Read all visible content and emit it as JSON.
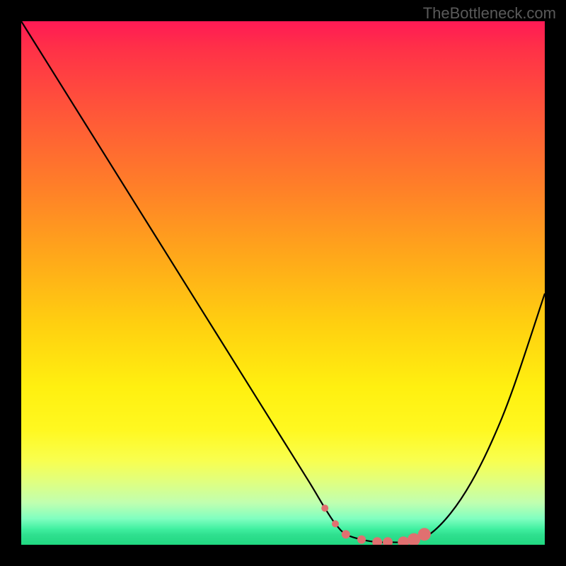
{
  "attribution": "TheBottleneck.com",
  "chart_data": {
    "type": "line",
    "title": "",
    "xlabel": "",
    "ylabel": "",
    "xlim": [
      0,
      100
    ],
    "ylim": [
      0,
      100
    ],
    "series": [
      {
        "name": "bottleneck-curve",
        "x": [
          0,
          5,
          10,
          15,
          20,
          25,
          30,
          35,
          40,
          45,
          50,
          55,
          58,
          60,
          62,
          65,
          68,
          70,
          73,
          75,
          78,
          82,
          86,
          90,
          94,
          100
        ],
        "y": [
          100,
          92,
          84,
          76,
          68,
          60,
          52,
          44,
          36,
          28,
          20,
          12,
          7,
          4,
          2,
          1,
          0.5,
          0.5,
          0.5,
          1,
          2,
          6,
          12,
          20,
          30,
          48
        ]
      }
    ],
    "markers": {
      "name": "highlight-dots",
      "color": "#e07070",
      "points": [
        {
          "x": 58,
          "y": 7,
          "r": 5
        },
        {
          "x": 60,
          "y": 4,
          "r": 5
        },
        {
          "x": 62,
          "y": 2,
          "r": 6
        },
        {
          "x": 65,
          "y": 1,
          "r": 6
        },
        {
          "x": 68,
          "y": 0.5,
          "r": 7
        },
        {
          "x": 70,
          "y": 0.5,
          "r": 7
        },
        {
          "x": 73,
          "y": 0.5,
          "r": 8
        },
        {
          "x": 75,
          "y": 1,
          "r": 9
        },
        {
          "x": 77,
          "y": 2,
          "r": 9
        }
      ]
    },
    "gradient_stops": [
      {
        "pos": 0,
        "color": "#ff1a55"
      },
      {
        "pos": 50,
        "color": "#ffd010"
      },
      {
        "pos": 100,
        "color": "#20d880"
      }
    ]
  }
}
